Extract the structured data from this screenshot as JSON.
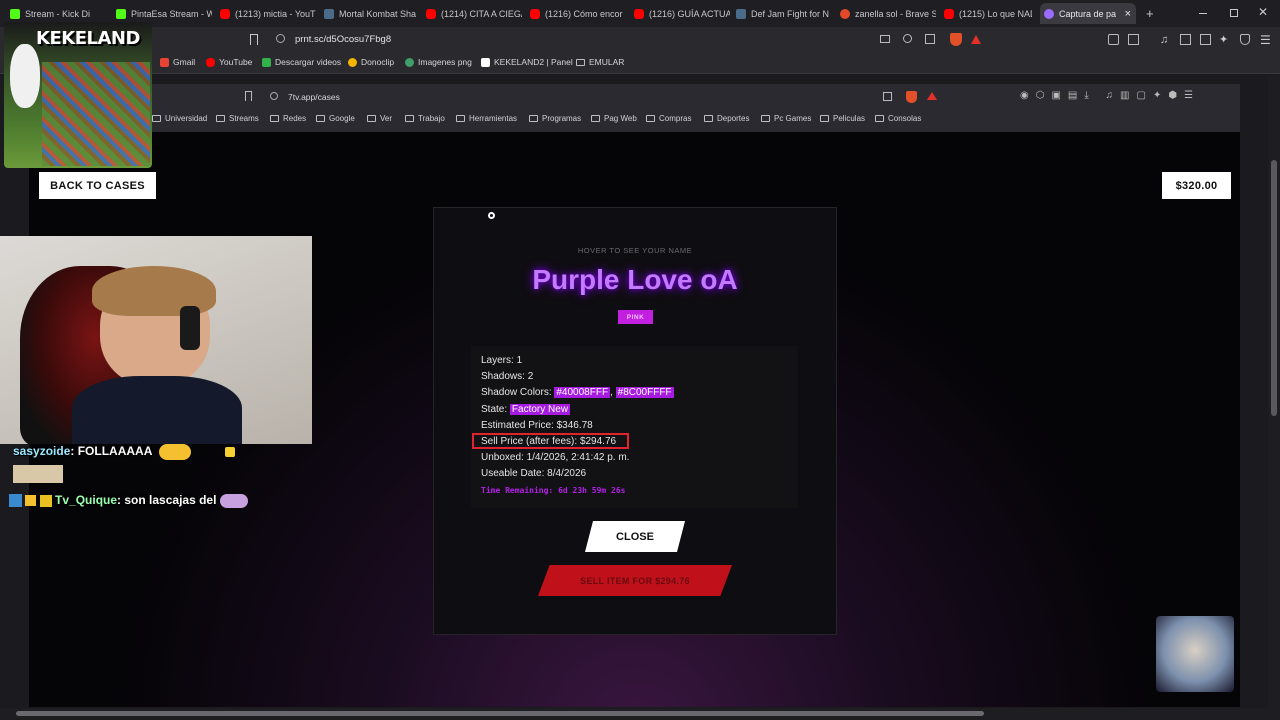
{
  "outer_tabs": [
    {
      "label": "Stream - Kick Di",
      "color": "#53fc18"
    },
    {
      "label": "PintaEsa Stream - W",
      "color": "#53fc18"
    },
    {
      "label": "(1213) mictia - YouT",
      "color": "#ff0000"
    },
    {
      "label": "Mortal Kombat Sha",
      "color": "#4a6b8a"
    },
    {
      "label": "(1214) CITA A CIEGA",
      "color": "#ff0000"
    },
    {
      "label": "(1216) Cómo encor",
      "color": "#ff0000"
    },
    {
      "label": "(1216) GUÍA ACTUA",
      "color": "#ff0000"
    },
    {
      "label": "Def Jam Fight for N",
      "color": "#4a6b8a"
    },
    {
      "label": "zanella sol - Brave S",
      "color": "#e24a2a"
    },
    {
      "label": "(1215) Lo que NAD",
      "color": "#ff0000"
    },
    {
      "label": "Captura de pa",
      "color": "#9a6bff"
    }
  ],
  "outer_url": "prnt.sc/d5Ocosu7Fbg8",
  "outer_bookmarks": [
    "Gmail",
    "YouTube",
    "Descargar videos",
    "Donoclip",
    "Imagenes png",
    "KEKELAND2 | Panel",
    "EMULAR"
  ],
  "inner_url": "7tv.app/cases",
  "inner_bookmarks": [
    "Universidad",
    "Streams",
    "Redes",
    "Google",
    "Ver",
    "Trabajo",
    "Herramientas",
    "Programas",
    "Pag Web",
    "Compras",
    "Deportes",
    "Pc Games",
    "Peliculas",
    "Consolas"
  ],
  "overlay_logo": "KEKELAND",
  "page": {
    "back_button": "BACK TO CASES",
    "balance": "$320.00",
    "hover_hint": "HOVER TO SEE YOUR NAME",
    "item_name": "Purple Love oA",
    "rarity_badge": "PINK",
    "details": {
      "layers_label": "Layers:",
      "layers": "1",
      "shadows_label": "Shadows:",
      "shadows": "2",
      "shadow_colors_label": "Shadow Colors:",
      "shadow_color_1": "#40008FFF",
      "shadow_color_2": "#8C00FFFF",
      "state_label": "State:",
      "state": "Factory New",
      "estimated_label": "Estimated Price:",
      "estimated": "$346.78",
      "sell_price_label": "Sell Price (after fees):",
      "sell_price": "$294.76",
      "unboxed_label": "Unboxed:",
      "unboxed": "1/4/2026, 2:41:42 p. m.",
      "useable_label": "Useable Date:",
      "useable": "8/4/2026",
      "time_remaining": "Time Remaining: 6d 23h 59m 26s"
    },
    "close_button": "CLOSE",
    "sell_button": "SELL ITEM FOR $294.76"
  },
  "chat": [
    {
      "user": "sasyzoide",
      "message": ": FOLLAAAAA"
    },
    {
      "user": "Tv_Quique",
      "message": ": son lascajas del"
    }
  ],
  "colors": {
    "accent": "#a61be0",
    "title_purple": "#c47aff",
    "sell_red": "#c0111b",
    "highlight_box": "#e0232e"
  }
}
